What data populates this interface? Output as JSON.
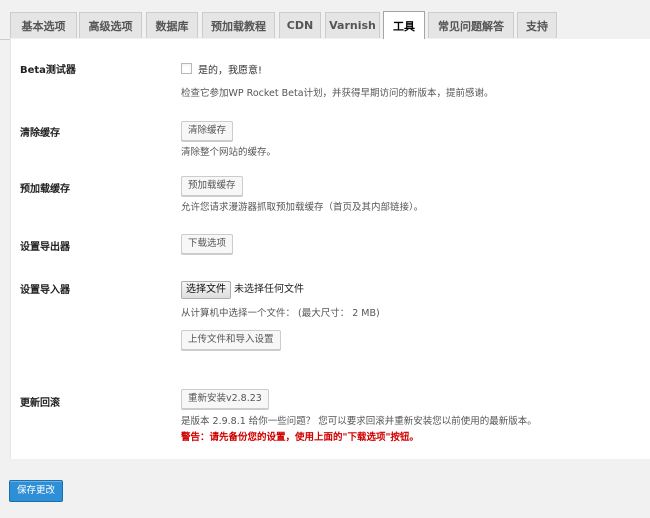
{
  "tabs": [
    {
      "label": "基本选项"
    },
    {
      "label": "高级选项"
    },
    {
      "label": "数据库"
    },
    {
      "label": "预加载教程"
    },
    {
      "label": "CDN"
    },
    {
      "label": "Varnish"
    },
    {
      "label": "工具",
      "active": true
    },
    {
      "label": "常见问题解答"
    },
    {
      "label": "支持"
    }
  ],
  "beta": {
    "label": "Beta测试器",
    "checkbox_label": "是的，我愿意!",
    "checked": false,
    "description": "检查它参加WP Rocket Beta计划，并获得早期访问的新版本，提前感谢。"
  },
  "clear_cache": {
    "label": "清除缓存",
    "button": "清除缓存",
    "description": "清除整个网站的缓存。"
  },
  "preload_cache": {
    "label": "预加载缓存",
    "button": "预加载缓存",
    "description": "允许您请求漫游器抓取预加载缓存（首页及其内部链接）。"
  },
  "export": {
    "label": "设置导出器",
    "button": "下载选项"
  },
  "import": {
    "label": "设置导入器",
    "file_button": "选择文件",
    "file_status": "未选择任何文件",
    "description": "从计算机中选择一个文件： (最大尺寸： 2 MB)",
    "upload_button": "上传文件和导入设置"
  },
  "rollback": {
    "label": "更新回滚",
    "button": "重新安装v2.8.23",
    "description": "是版本 2.9.8.1 给你一些问题？ 您可以要求回滚并重新安装您以前使用的最新版本。",
    "warning": "警告：请先备份您的设置，使用上面的\"下载选项\"按钮。"
  },
  "footer": {
    "save_button": "保存更改"
  },
  "colors": {
    "primary_button": "#2e8ed6",
    "warning_text": "#d00000",
    "panel_bg": "#ffffff",
    "page_bg": "#f1f1f1"
  }
}
